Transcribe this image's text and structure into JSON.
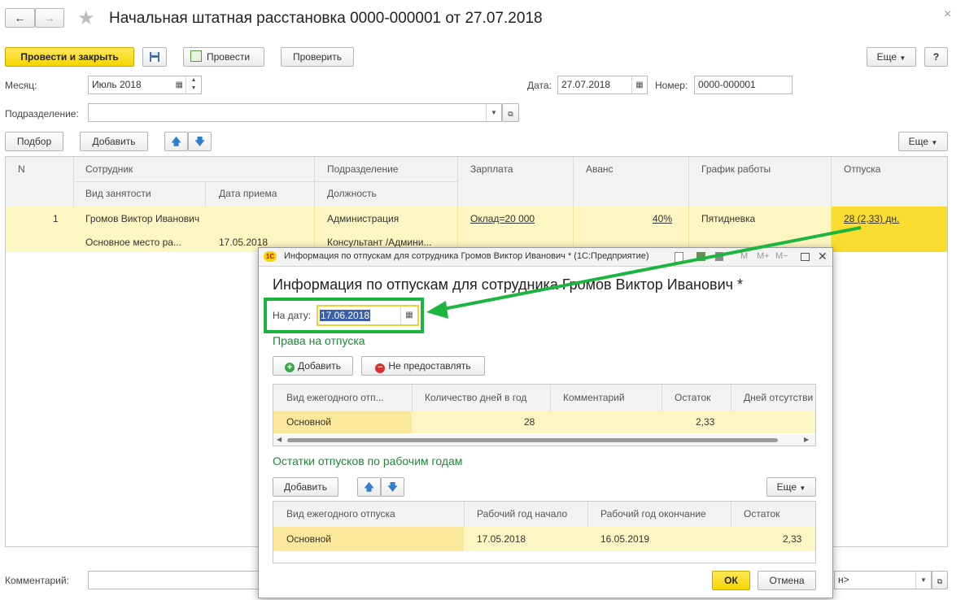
{
  "window": {
    "title": "Начальная штатная расстановка 0000-000001 от 27.07.2018",
    "close_glyph": "×"
  },
  "toolbar": {
    "post_close": "Провести и закрыть",
    "post": "Провести",
    "check": "Проверить",
    "more": "Еще",
    "help": "?"
  },
  "header": {
    "month_label": "Месяц:",
    "month_value": "Июль 2018",
    "date_label": "Дата:",
    "date_value": "27.07.2018",
    "number_label": "Номер:",
    "number_value": "0000-000001",
    "dept_label": "Подразделение:",
    "dept_value": ""
  },
  "table_toolbar": {
    "pick": "Подбор",
    "add": "Добавить",
    "more": "Еще"
  },
  "table": {
    "columns": {
      "n": "N",
      "employee": "Сотрудник",
      "employment_type": "Вид занятости",
      "hire_date": "Дата приема",
      "department": "Подразделение",
      "position": "Должность",
      "salary": "Зарплата",
      "advance": "Аванс",
      "schedule": "График работы",
      "vacations": "Отпуска"
    },
    "rows": [
      {
        "n": "1",
        "employee": "Громов Виктор Иванович",
        "employment_type": "Основное место ра...",
        "hire_date": "17.05.2018",
        "department": "Администрация",
        "position": "Консультант /Админи...",
        "salary": "Оклад=20 000",
        "advance": "40%",
        "schedule": "Пятидневка",
        "vacations": "28 (2,33) дн."
      }
    ]
  },
  "footer": {
    "comment_label": "Комментарий:",
    "responsible_value": "н>"
  },
  "dialog": {
    "window_title": "Информация по отпускам для сотрудника Громов Виктор Иванович * (1С:Предприятие)",
    "title": "Информация по отпускам для сотрудника Громов Виктор Иванович *",
    "date_label": "На дату:",
    "date_value": "17.06.2018",
    "rights_section": "Права на отпуска",
    "add_btn": "Добавить",
    "deny_btn": "Не предоставлять",
    "rights_columns": [
      "Вид ежегодного отп...",
      "Количество дней в год",
      "Комментарий",
      "Остаток",
      "Дней отсутстви"
    ],
    "rights_rows": [
      {
        "type": "Основной",
        "days": "28",
        "comment": "",
        "rest": "2,33",
        "absent": ""
      }
    ],
    "balance_section": "Остатки отпусков по рабочим годам",
    "balance_add": "Добавить",
    "balance_more": "Еще",
    "balance_columns": [
      "Вид ежегодного отпуска",
      "Рабочий год начало",
      "Рабочий год окончание",
      "Остаток"
    ],
    "balance_rows": [
      {
        "type": "Основной",
        "start": "17.05.2018",
        "end": "16.05.2019",
        "rest": "2,33"
      }
    ],
    "ok": "ОК",
    "cancel": "Отмена",
    "logo": "1С",
    "m": "M",
    "m_plus": "M+",
    "m_minus": "M−"
  },
  "colors": {
    "accent_yellow": "#f6d600",
    "row_highlight": "#fdf6c3",
    "selected_cell": "#fbdc30",
    "green_annotation": "#1db53f",
    "section_green": "#1a8a35"
  }
}
